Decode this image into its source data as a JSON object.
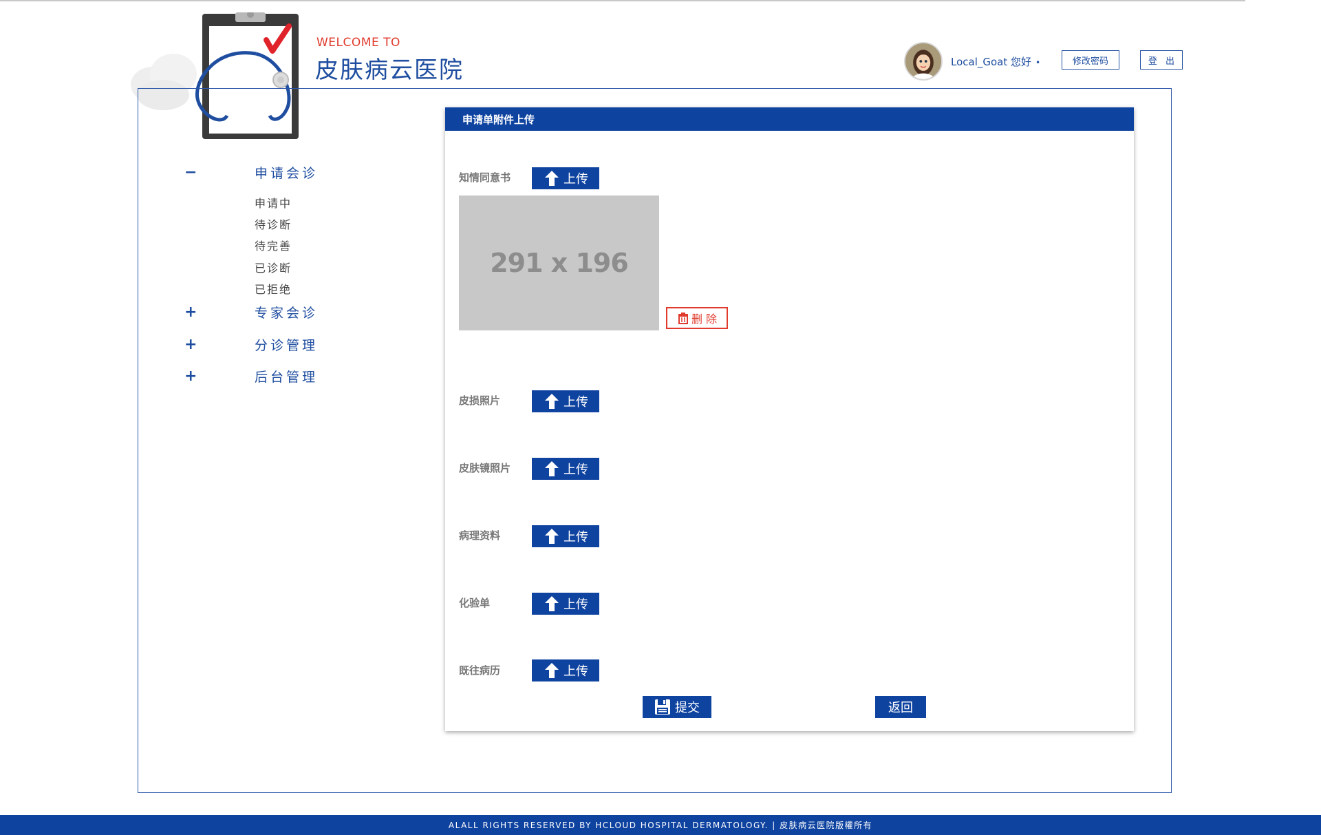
{
  "header": {
    "welcome": "WELCOME TO",
    "brand": "皮肤病云医院",
    "user_greeting": "Local_Goat 您好",
    "greeting_dot": "•",
    "change_password_label": "修改密码",
    "logout_label": "登 出"
  },
  "sidebar": {
    "sections": [
      {
        "sign": "−",
        "title": "申请会诊",
        "items": [
          "申请中",
          "待诊断",
          "待完善",
          "已诊断",
          "已拒绝"
        ]
      },
      {
        "sign": "+",
        "title": "专家会诊"
      },
      {
        "sign": "+",
        "title": "分诊管理"
      },
      {
        "sign": "+",
        "title": "后台管理"
      }
    ]
  },
  "panel": {
    "title": "申请单附件上传",
    "upload_label": "上传",
    "rows": [
      {
        "label": "知情同意书"
      },
      {
        "label": "皮损照片"
      },
      {
        "label": "皮肤镜照片"
      },
      {
        "label": "病理资料"
      },
      {
        "label": "化验单"
      },
      {
        "label": "既往病历"
      }
    ],
    "placeholder_text": "291 x 196",
    "delete_label": "删 除",
    "submit_label": "提交",
    "back_label": "返回"
  },
  "footer": {
    "text": "ALALL RIGHTS RESERVED BY HCLOUD HOSPITAL DERMATOLOGY. | 皮肤病云医院版權所有"
  },
  "colors": {
    "primary": "#0f43a0",
    "accent": "#e03a2c",
    "placeholder": "#c8c8c8"
  },
  "icons": [
    "logo-clipboard-icon",
    "upload-arrow-icon",
    "trash-icon",
    "save-disk-icon"
  ]
}
